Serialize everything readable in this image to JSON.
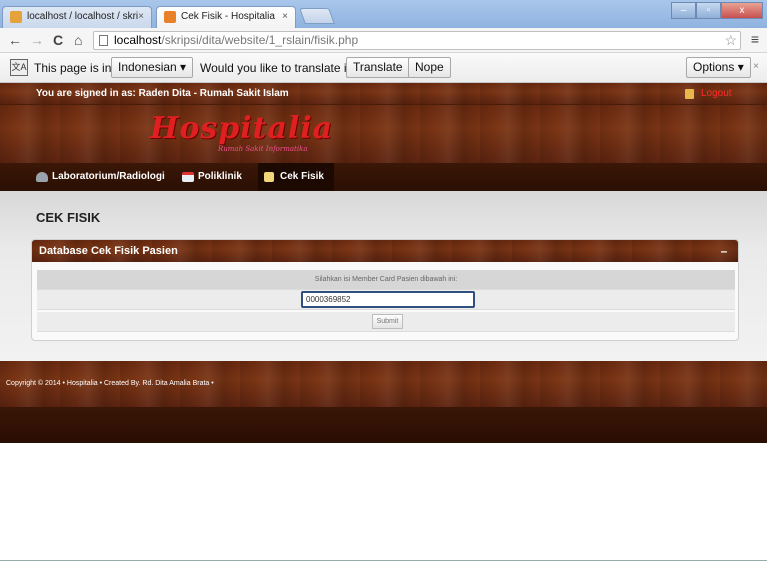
{
  "browser": {
    "tabs": [
      {
        "label": "localhost / localhost / skri",
        "favicon_color": "#e5a23a"
      },
      {
        "label": "Cek Fisik - Hospitalia",
        "favicon_color": "#e8812a"
      }
    ],
    "window_buttons": {
      "minimize": "–",
      "maximize": "▫",
      "close": "x"
    },
    "url": {
      "host": "localhost",
      "path": "/skripsi/dita/website/1_rslain/fisik.php"
    },
    "nav": {
      "back": "←",
      "forward": "→",
      "reload": "C",
      "home": "⌂"
    },
    "star": "☆",
    "menu": "≡"
  },
  "translate_bar": {
    "icon_text": "文A",
    "prefix": "This page is in",
    "language": "Indonesian ▾",
    "question": "Would you like to translate it?",
    "translate_label": "Translate",
    "nope_label": "Nope",
    "options_label": "Options ▾",
    "close": "×"
  },
  "site": {
    "signed_in_text": "You are signed in as: Raden Dita - Rumah Sakit Islam",
    "logout_label": "Logout",
    "logo_text": "Hospitalia",
    "logo_sub": "Rumah Sakit Informatika",
    "nav_items": [
      {
        "label": "Laboratorium/Radiologi",
        "icon": "flask-icon"
      },
      {
        "label": "Poliklinik",
        "icon": "calendar-icon"
      },
      {
        "label": "Cek Fisik",
        "icon": "document-icon"
      }
    ],
    "page_title": "CEK FISIK",
    "panel_title": "Database Cek Fisik Pasien",
    "collapse_label": "–",
    "instruction": "Silahkan isi Member Card Pasien dibawah ini:",
    "member_card_value": "0000369852",
    "submit_label": "Submit",
    "footer_text": "Copyright © 2014 • Hospitalia • Created By. Rd. Dita Amalia Brata •"
  },
  "colors": {
    "wood": "#6a2a10",
    "logout": "#ff2a2a",
    "logo": "#e02020"
  }
}
